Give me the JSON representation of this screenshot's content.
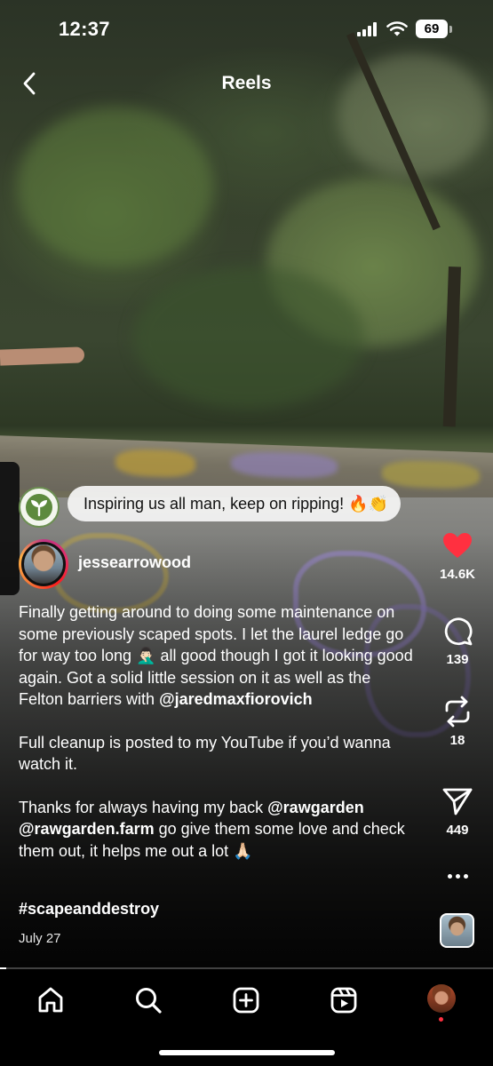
{
  "status_bar": {
    "time": "12:37",
    "battery": "69",
    "icons": [
      "cellular-signal-icon",
      "wifi-icon",
      "battery-icon"
    ]
  },
  "header": {
    "title": "Reels",
    "back_icon": "chevron-left-icon"
  },
  "pinned_comment": {
    "avatar_icon": "sprout-icon",
    "text": "Inspiring us all man, keep on ripping! 🔥👏"
  },
  "author": {
    "username": "jessearrowood"
  },
  "caption": {
    "paragraphs": [
      [
        {
          "text": "Finally getting around to doing some maintenance on some previously scaped spots. I let the laurel ledge go for way too long 🤦🏻‍♂️ all good though I got it looking good again. Got a solid little session on it as well as the Felton barriers with "
        },
        {
          "text": "@jaredmaxfiorovich",
          "mention": true
        }
      ],
      [
        {
          "text": "Full cleanup is posted to my YouTube if you’d wanna watch it."
        }
      ],
      [
        {
          "text": "Thanks for always having my back "
        },
        {
          "text": "@rawgarden",
          "mention": true
        },
        {
          "text": " "
        },
        {
          "text": "@rawgarden.farm",
          "mention": true
        },
        {
          "text": " go give them some love and check them out, it helps me out a lot 🙏🏻"
        }
      ]
    ],
    "hashtag": "#scapeanddestroy",
    "date": "July 27"
  },
  "actions": {
    "like": {
      "count": "14.6K",
      "icon": "heart-filled-icon",
      "liked": true,
      "color": "#ff3040"
    },
    "comment": {
      "count": "139",
      "icon": "comment-icon"
    },
    "repost": {
      "count": "18",
      "icon": "repost-icon"
    },
    "share": {
      "count": "449",
      "icon": "paper-plane-icon"
    },
    "more_icon": "more-horizontal-icon"
  },
  "playback": {
    "progress_fraction": 0.012
  },
  "tab_bar": {
    "tabs": [
      {
        "name": "home",
        "icon": "home-icon"
      },
      {
        "name": "search",
        "icon": "search-icon"
      },
      {
        "name": "create",
        "icon": "plus-square-icon"
      },
      {
        "name": "reels",
        "icon": "reels-icon",
        "active": true
      },
      {
        "name": "profile",
        "icon": "profile-avatar"
      }
    ],
    "notification_dot_color": "#ff3040"
  }
}
